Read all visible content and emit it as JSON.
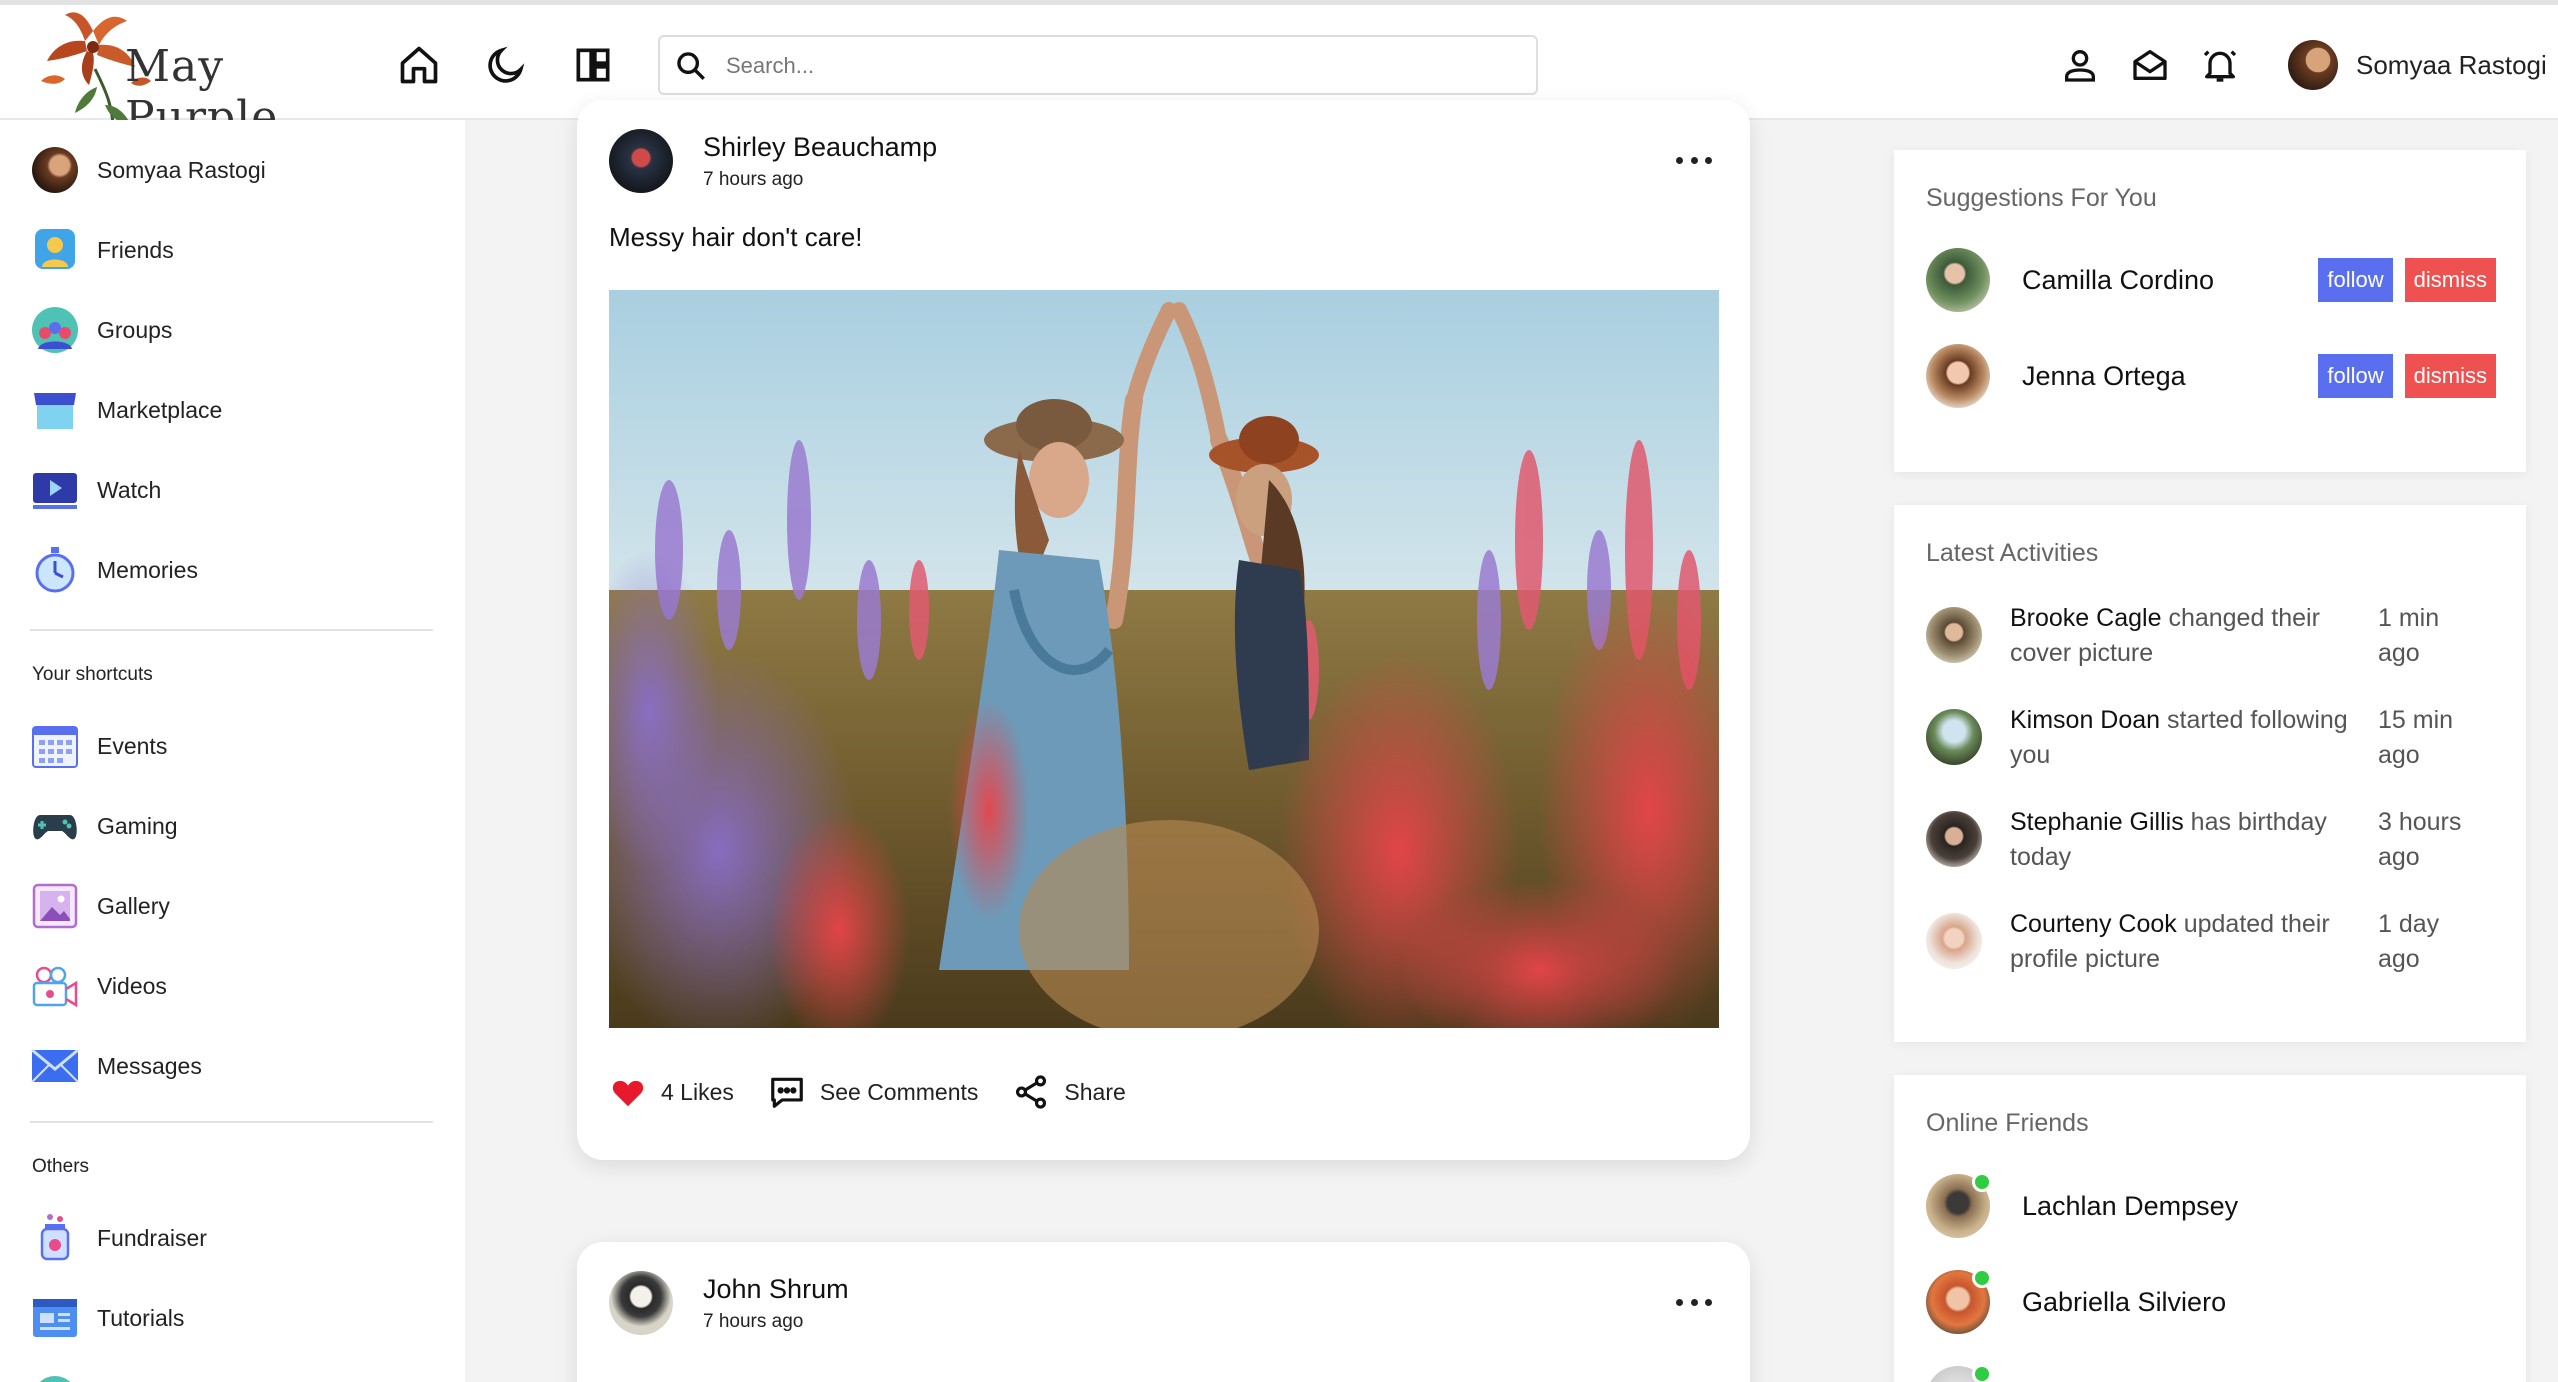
{
  "app": {
    "logo_text": "May Purple"
  },
  "search": {
    "placeholder": "Search..."
  },
  "current_user": {
    "name": "Somyaa Rastogi"
  },
  "sidebar": {
    "items": [
      {
        "label": "Somyaa Rastogi",
        "icon": "avatar"
      },
      {
        "label": "Friends",
        "icon": "friends-icon"
      },
      {
        "label": "Groups",
        "icon": "groups-icon"
      },
      {
        "label": "Marketplace",
        "icon": "marketplace-icon"
      },
      {
        "label": "Watch",
        "icon": "watch-icon"
      },
      {
        "label": "Memories",
        "icon": "memories-icon"
      }
    ],
    "shortcuts_heading": "Your shortcuts",
    "shortcuts": [
      {
        "label": "Events",
        "icon": "events-icon"
      },
      {
        "label": "Gaming",
        "icon": "gaming-icon"
      },
      {
        "label": "Gallery",
        "icon": "gallery-icon"
      },
      {
        "label": "Videos",
        "icon": "videos-icon"
      },
      {
        "label": "Messages",
        "icon": "messages-icon"
      }
    ],
    "others_heading": "Others",
    "others": [
      {
        "label": "Fundraiser",
        "icon": "fundraiser-icon"
      },
      {
        "label": "Tutorials",
        "icon": "tutorials-icon"
      }
    ]
  },
  "posts": [
    {
      "author": "Shirley Beauchamp",
      "time": "7 hours ago",
      "text": "Messy hair don't care!",
      "likes_label": "4 Likes",
      "comments_label": "See Comments",
      "share_label": "Share"
    },
    {
      "author": "John Shrum",
      "time": "7 hours ago"
    }
  ],
  "suggestions": {
    "title": "Suggestions For You",
    "follow_label": "follow",
    "dismiss_label": "dismiss",
    "people": [
      {
        "name": "Camilla Cordino"
      },
      {
        "name": "Jenna Ortega"
      }
    ]
  },
  "activities": {
    "title": "Latest Activities",
    "items": [
      {
        "name": "Brooke Cagle",
        "action": "changed their cover picture",
        "ago": "1 min ago"
      },
      {
        "name": "Kimson Doan",
        "action": "started following you",
        "ago": "15 min ago"
      },
      {
        "name": "Stephanie Gillis",
        "action": "has birthday today",
        "ago": "3 hours ago"
      },
      {
        "name": "Courteny Cook",
        "action": "updated their profile picture",
        "ago": "1 day ago"
      }
    ]
  },
  "online_friends": {
    "title": "Online Friends",
    "people": [
      {
        "name": "Lachlan Dempsey"
      },
      {
        "name": "Gabriella Silviero"
      }
    ]
  },
  "colors": {
    "follow": "#5a6ff0",
    "dismiss": "#ef5050",
    "online": "#2ecc40",
    "like": "#e8192c"
  }
}
